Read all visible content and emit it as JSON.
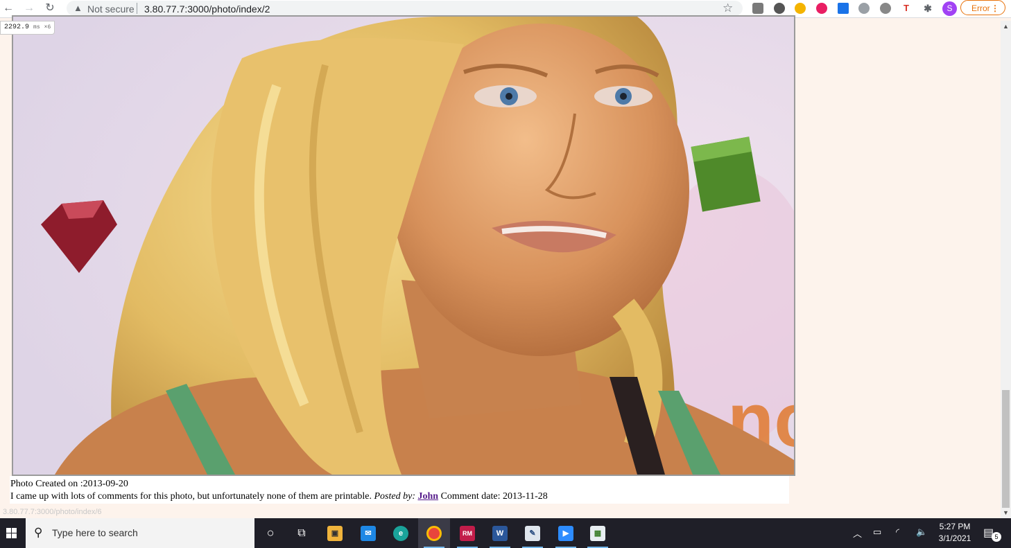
{
  "browser": {
    "security_label": "Not secure",
    "url": "3.80.77.7:3000/photo/index/2",
    "error_label": "Error",
    "profile_initial": "S",
    "icons": [
      "back-icon",
      "forward-icon",
      "reload-icon",
      "warning-icon",
      "star-icon",
      "extensions-icon",
      "menu-icon"
    ]
  },
  "perf_badge": {
    "value": "2292.9",
    "unit": "ms",
    "multiplier": "×6"
  },
  "photo": {
    "description_alt": "photo",
    "created_label": "Photo Created on :2013-09-20",
    "comment_text": "I came up with lots of comments for this photo, but unfortunately none of them are printable.",
    "posted_by_label": "Posted by:",
    "author": "John",
    "comment_date_label": "Comment date: 2013-11-28"
  },
  "status_url": "3.80.77.7:3000/photo/index/6",
  "taskbar": {
    "search_placeholder": "Type here to search",
    "time": "5:27 PM",
    "date": "3/1/2021",
    "notification_count": "5"
  },
  "colors": {
    "page_bg": "#fdf3ec",
    "link": "#551a8b",
    "error": "#e8710a",
    "taskbar": "#1f1f28"
  }
}
